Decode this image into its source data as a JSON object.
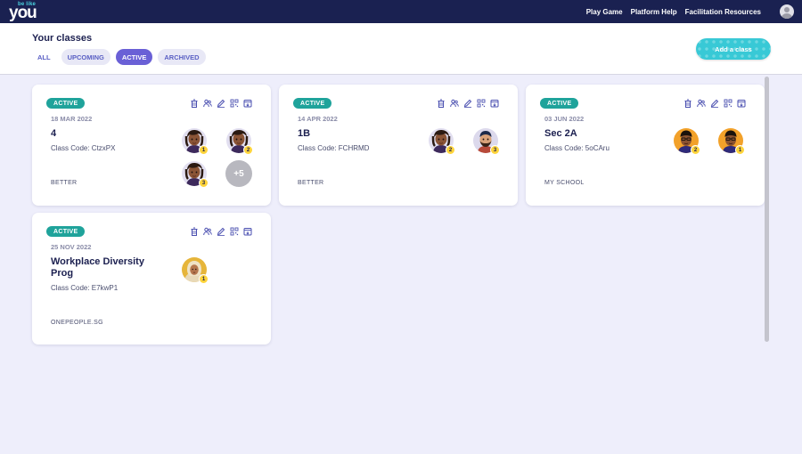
{
  "nav": {
    "logo_small": "be like",
    "logo_main": "you",
    "links": [
      "Play Game",
      "Platform Help",
      "Facilitation Resources"
    ]
  },
  "header": {
    "title": "Your classes",
    "filters": [
      "ALL",
      "UPCOMING",
      "ACTIVE",
      "ARCHIVED"
    ],
    "selected_filter": "ACTIVE",
    "add_button": "Add a class"
  },
  "icons": [
    "trash-icon",
    "people-icon",
    "edit-icon",
    "qr-icon",
    "archive-icon"
  ],
  "colors": {
    "nav_bg": "#1a2151",
    "accent": "#6a60d6",
    "badge": "#1fa39b",
    "add_button": "#38c9d6",
    "rank_badge": "#ffd43b"
  },
  "cards": [
    {
      "status": "ACTIVE",
      "date": "18 MAR 2022",
      "name": "4",
      "code": "Class Code: CtzxPX",
      "school": "BETTER",
      "avatars": [
        "1",
        "2",
        "3"
      ],
      "more": "+5"
    },
    {
      "status": "ACTIVE",
      "date": "14 APR 2022",
      "name": "1B",
      "code": "Class Code: FCHRMD",
      "school": "BETTER",
      "avatars": [
        "2",
        "3"
      ]
    },
    {
      "status": "ACTIVE",
      "date": "03 JUN 2022",
      "name": "Sec 2A",
      "code": "Class Code: 5oCAru",
      "school": "MY SCHOOL",
      "avatars": [
        "2",
        "1"
      ]
    },
    {
      "status": "ACTIVE",
      "date": "25 NOV 2022",
      "name": "Workplace Diversity Prog",
      "code": "Class Code: E7kwP1",
      "school": "ONEPEOPLE.SG",
      "avatars": [
        "1"
      ]
    }
  ]
}
